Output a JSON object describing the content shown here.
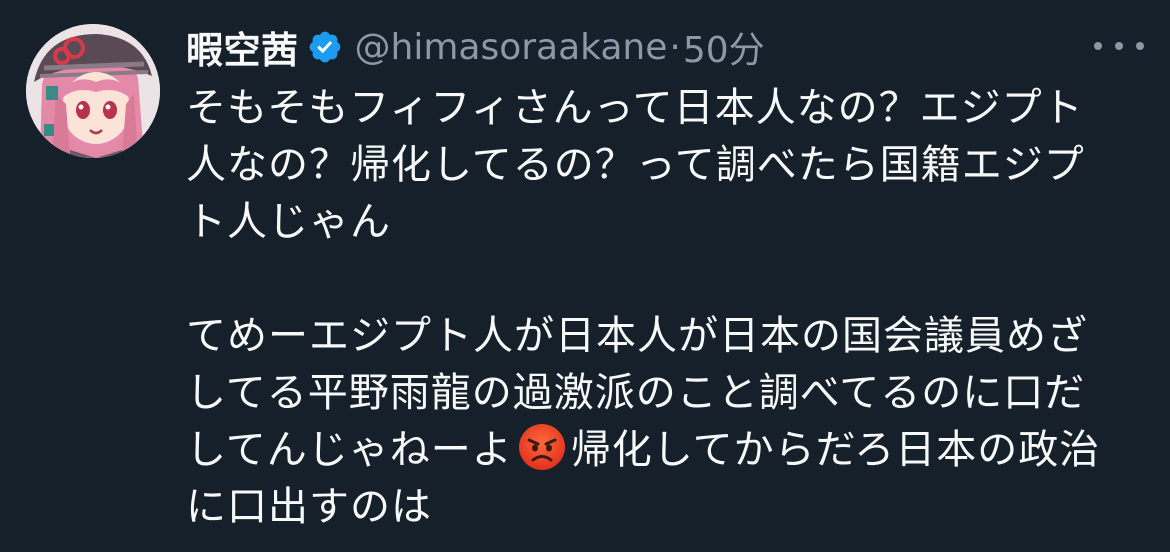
{
  "tweet": {
    "display_name": "暇空茜",
    "handle": "@himasoraakane",
    "separator": "·",
    "timestamp": "50分",
    "verified_icon": "verified-badge-icon",
    "more_icon": "more-horizontal-icon",
    "avatar_icon": "user-avatar",
    "body_lines": {
      "l1": "そもそもフィフィさんって日本人なの？エジプト",
      "l2": "人なの？帰化してるの？って調べたら国籍エジプ",
      "l3": "ト人じゃん",
      "l4": "",
      "l5": "てめーエジプト人が日本人が日本の国会議員めざ",
      "l6": "してる平野雨龍の過激派のこと調べてるのに口だ",
      "l7a": "してんじゃねーよ",
      "l7b": "帰化してからだろ日本の政治",
      "l8": "に口出すのは"
    },
    "emoji_icon": "angry-face-emoji",
    "colors": {
      "background": "#15202b",
      "text": "#f7f9f9",
      "secondary": "#8b98a5",
      "verified": "#1d9bf0"
    }
  }
}
